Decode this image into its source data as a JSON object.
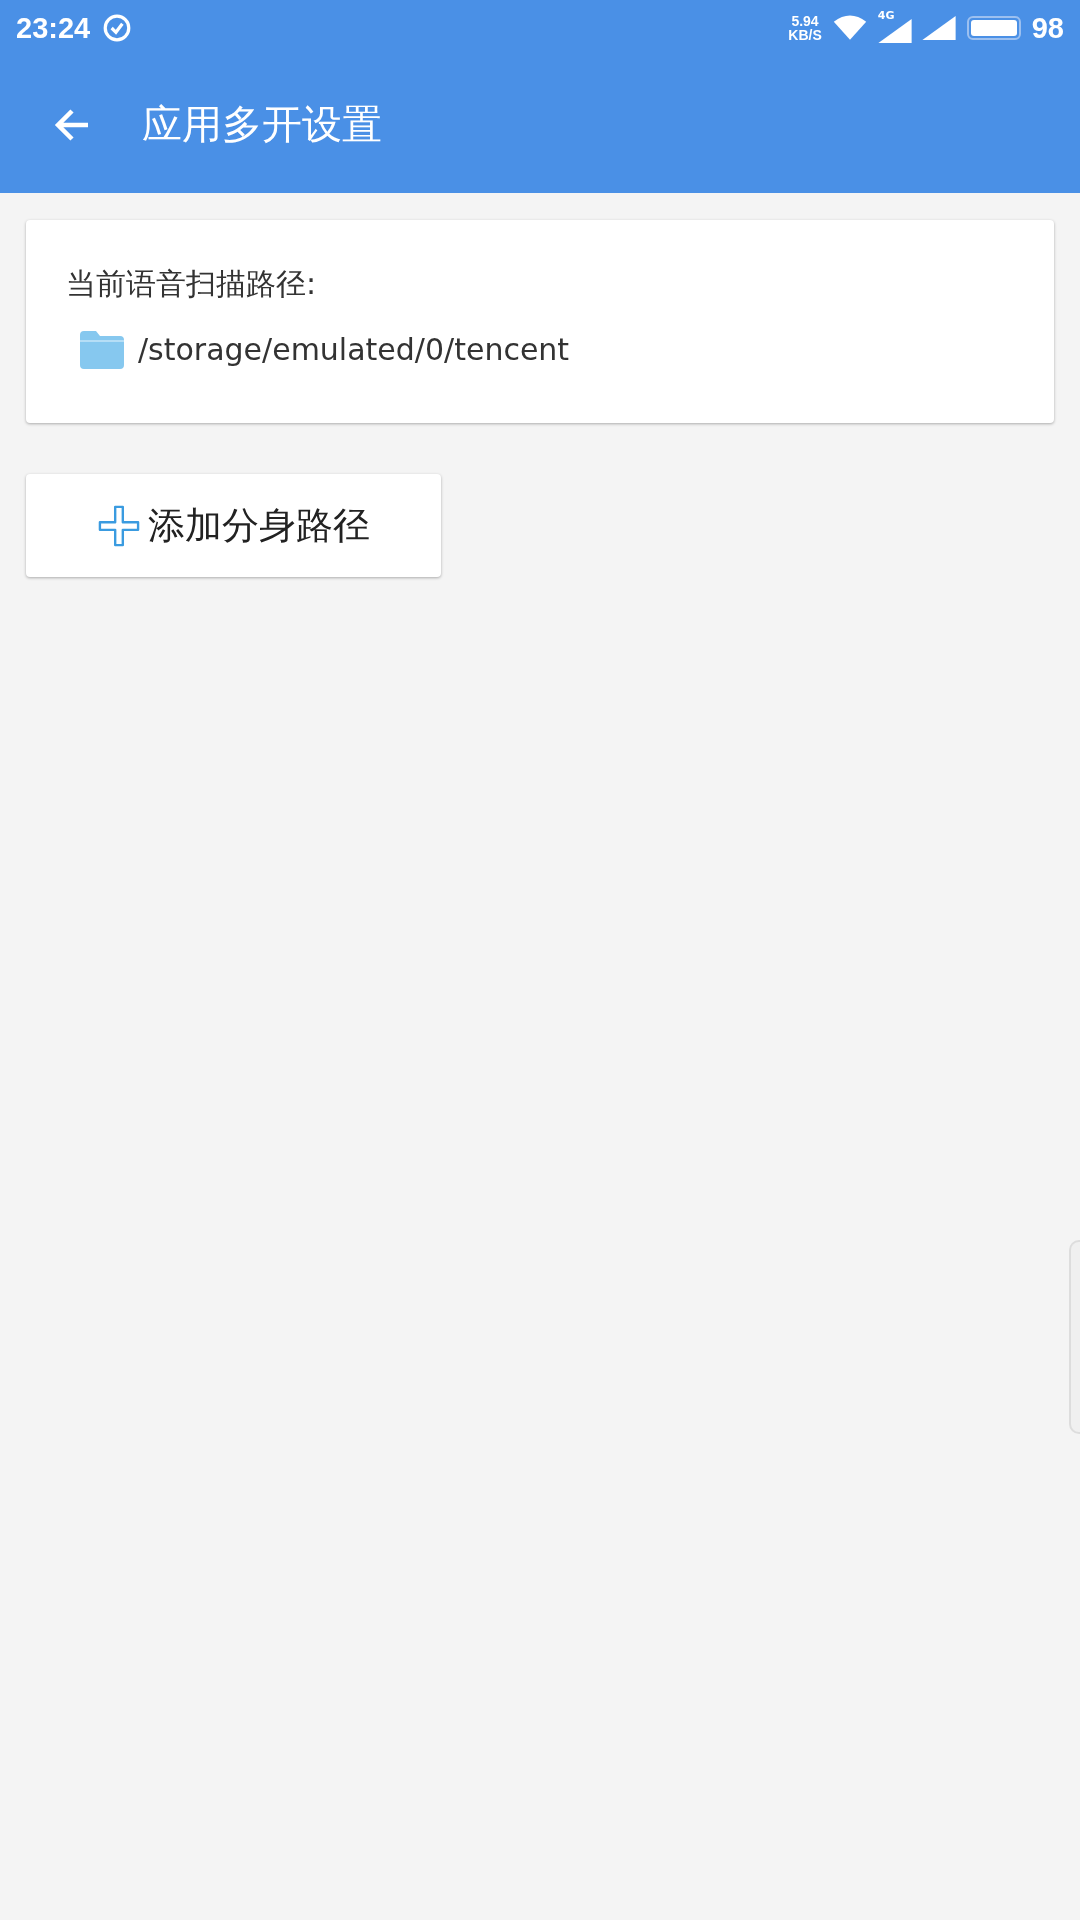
{
  "status_bar": {
    "time": "23:24",
    "speed_value": "5.94",
    "speed_unit": "KB/S",
    "network": "4G",
    "battery": "98"
  },
  "toolbar": {
    "title": "应用多开设置"
  },
  "scan_card": {
    "label": "当前语音扫描路径:",
    "path": "/storage/emulated/0/tencent"
  },
  "add_button": {
    "label": "添加分身路径"
  }
}
